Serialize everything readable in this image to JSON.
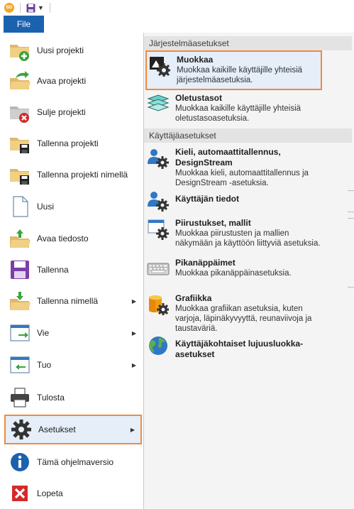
{
  "menubar": {
    "file_label": "File"
  },
  "left_menu": [
    {
      "label": "Uusi projekti"
    },
    {
      "label": "Avaa projekti"
    },
    {
      "label": "Sulje projekti"
    },
    {
      "label": "Tallenna projekti"
    },
    {
      "label": "Tallenna projekti nimellä"
    },
    {
      "label": "Uusi"
    },
    {
      "label": "Avaa tiedosto"
    },
    {
      "label": "Tallenna"
    },
    {
      "label": "Tallenna nimellä"
    },
    {
      "label": "Vie"
    },
    {
      "label": "Tuo"
    },
    {
      "label": "Tulosta"
    },
    {
      "label": "Asetukset"
    },
    {
      "label": "Tämä ohjelmaversio"
    },
    {
      "label": "Lopeta"
    }
  ],
  "right_panel": {
    "section_system": "Järjestelmäasetukset",
    "section_user": "Käyttäjäasetukset",
    "items": [
      {
        "title": "Muokkaa",
        "desc": "Muokkaa kaikille käyttäjille yhteisiä järjestelmäasetuksia."
      },
      {
        "title": "Oletustasot",
        "desc": "Muokkaa kaikille käyttäjille yhteisiä oletustasoasetuksia."
      },
      {
        "title": "Kieli, automaattitallennus, DesignStream",
        "desc": "Muokkaa kieli, automaattitallennus ja DesignStream -asetuksia."
      },
      {
        "title": "Käyttäjän tiedot",
        "desc": ""
      },
      {
        "title": "Piirustukset, mallit",
        "desc": "Muokkaa piirustusten ja mallien näkymään ja käyttöön liittyviä asetuksia."
      },
      {
        "title": "Pikanäppäimet",
        "desc": "Muokkaa pikanäppäinasetuksia."
      },
      {
        "title": "Grafiikka",
        "desc": "Muokkaa grafiikan asetuksia, kuten varjoja, läpinäkyvyyttä, reunaviivoja ja taustaväriä."
      },
      {
        "title": "Käyttäjäkohtaiset lujuusluokka-asetukset",
        "desc": ""
      }
    ]
  }
}
